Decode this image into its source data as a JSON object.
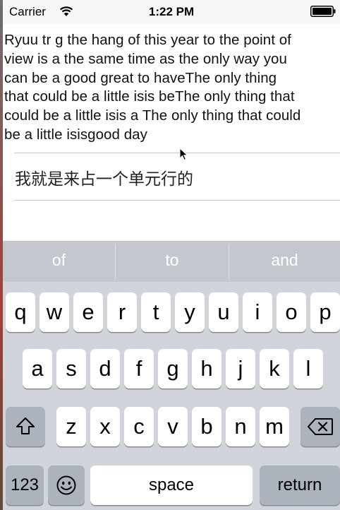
{
  "status_bar": {
    "carrier": "Carrier",
    "time": "1:22 PM"
  },
  "text_view": {
    "lines": [
      "Ryuu tr g the hang of this year to the point of",
      "view is a the same time as the only way you",
      "can be a good great to haveThe only thing",
      "that could be a little isis beThe only thing that",
      "could be a little isis a The only thing that could",
      "be a little isisgood day"
    ]
  },
  "table_cell": {
    "label": "我就是来占一个单元行的"
  },
  "keyboard": {
    "suggestions": [
      "of",
      "to",
      "and"
    ],
    "row1": [
      "q",
      "w",
      "e",
      "r",
      "t",
      "y",
      "u",
      "i",
      "o",
      "p"
    ],
    "row2": [
      "a",
      "s",
      "d",
      "f",
      "g",
      "h",
      "j",
      "k",
      "l"
    ],
    "row3": [
      "z",
      "x",
      "c",
      "v",
      "b",
      "n",
      "m"
    ],
    "numbers_label": "123",
    "space_label": "space",
    "return_label": "return",
    "icons": {
      "shift": "shift-icon",
      "delete": "delete-icon",
      "emoji": "emoji-icon"
    }
  }
}
